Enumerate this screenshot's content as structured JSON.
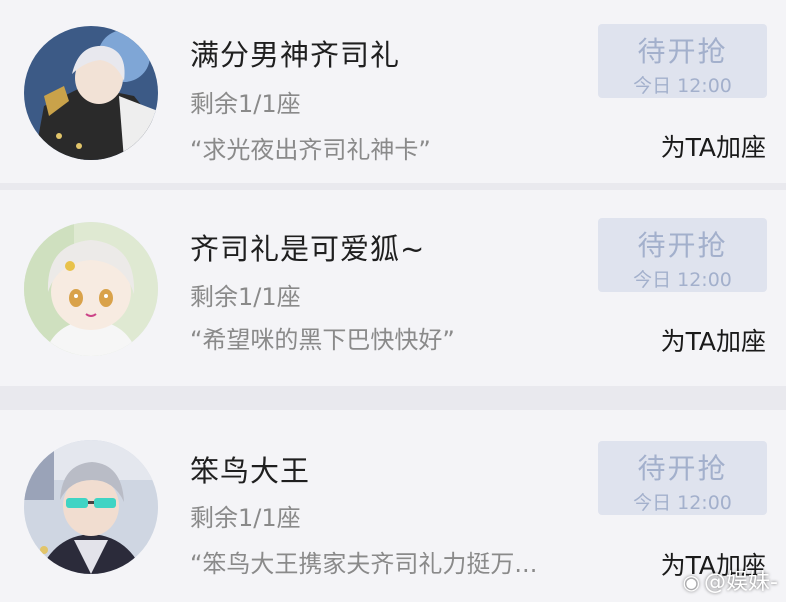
{
  "entries": [
    {
      "name": "满分男神齐司礼",
      "seats": "剩余1/1座",
      "quote": "“求光夜出齐司礼神卡”",
      "wait_label": "待开抢",
      "wait_time": "今日 12:00",
      "add_label": "为TA加座"
    },
    {
      "name": "齐司礼是可爱狐~",
      "seats": "剩余1/1座",
      "quote": "“希望咪的黑下巴快快好”",
      "wait_label": "待开抢",
      "wait_time": "今日 12:00",
      "add_label": "为TA加座"
    },
    {
      "name": "笨鸟大王",
      "seats": "剩余1/1座",
      "quote": "“笨鸟大王携家夫齐司礼力挺万...",
      "wait_label": "待开抢",
      "wait_time": "今日 12:00",
      "add_label": "为TA加座"
    }
  ],
  "watermark": {
    "icon": "weibo-icon",
    "text": "@娱妹-"
  },
  "colors": {
    "card_bg": "#f4f4f7",
    "page_bg": "#e9e9ee",
    "button_bg": "#dfe3ee",
    "button_text": "#a3b0cc",
    "secondary_text": "#8a8a8a"
  }
}
